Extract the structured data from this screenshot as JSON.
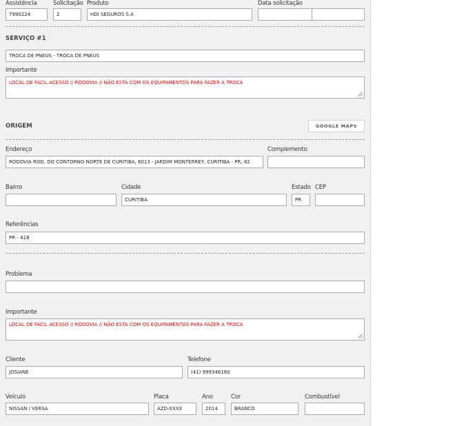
{
  "top": {
    "assistencia_label": "Assistência",
    "assistencia_value": "7990224",
    "solicitacao_label": "Solicitação",
    "solicitacao_value": "2",
    "produto_label": "Produto",
    "produto_value": "HDI SEGUROS S.A",
    "data_label": "Data solicitação",
    "data_value": "",
    "hora_value": ""
  },
  "servico": {
    "title": "SERVIÇO #1",
    "tipo_value": "TROCA DE PNEUS - TROCA DE PNEUS",
    "importante_label": "Importante",
    "importante_value": "LOCAL DE FACIL ACESSO // RODOVIA // NÃO ESTA COM OS EQUIPAMENTOS PARA FAZER A TROCA"
  },
  "origem": {
    "title": "ORIGEM",
    "google_maps_button": "GOOGLE MAPS",
    "endereco_label": "Endereço",
    "endereco_value": "RODOVIA ROD. DO CONTORNO NORTE DE CURITIBA, 6013 - JARDIM MONTERREY, CURITIBA - PR, 82",
    "complemento_label": "Complemento",
    "complemento_value": "",
    "bairro_label": "Bairro",
    "bairro_value": "",
    "cidade_label": "Cidade",
    "cidade_value": "CURITIBA",
    "estado_label": "Estado",
    "estado_value": "PR",
    "cep_label": "CEP",
    "cep_value": "",
    "referencias_label": "Referências",
    "referencias_value": "PR - 418"
  },
  "problema": {
    "problema_label": "Problema",
    "problema_value": "",
    "importante_label": "Importante",
    "importante_value": "LOCAL DE FACIL ACESSO // RODOVIA // NÃO ESTA COM OS EQUIPAMENTOS PARA FAZER A TROCA"
  },
  "cliente": {
    "cliente_label": "Cliente",
    "cliente_value": "JOSIANE",
    "telefone_label": "Telefone",
    "telefone_value": "(41) 999346160"
  },
  "veiculo": {
    "veiculo_label": "Veículo",
    "veiculo_value": "NISSAN / VERSA",
    "placa_label": "Placa",
    "placa_value": "AZD-XXXX",
    "ano_label": "Ano",
    "ano_value": "2014",
    "cor_label": "Cor",
    "cor_value": "BRANCO",
    "combustivel_label": "Combustível",
    "combustivel_value": ""
  },
  "colors": {
    "panel_bg": "#f1f1f1",
    "warning_text": "#e10000",
    "input_border": "#a9a9a9"
  }
}
